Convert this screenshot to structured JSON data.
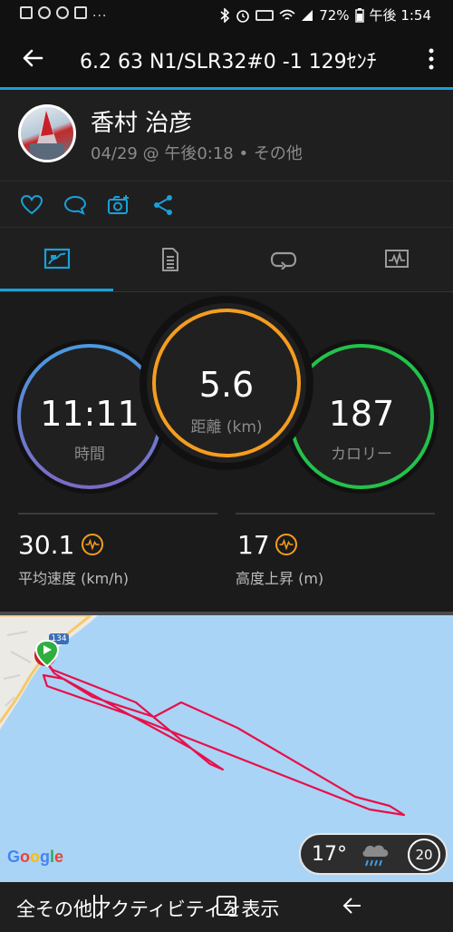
{
  "status_bar": {
    "dots": "...",
    "battery": "72%",
    "time": "午後 1:54"
  },
  "app_bar": {
    "title": "6.2 63 N1/SLR32#0 -1 129ｾﾝﾁ"
  },
  "profile": {
    "name": "香村 治彦",
    "date": "04/29 @ 午後0:18",
    "separator": "•",
    "activity_type": "その他"
  },
  "stats": {
    "time": {
      "value": "11:11",
      "label": "時間"
    },
    "distance": {
      "value": "5.6",
      "label": "距離 (km)"
    },
    "calories": {
      "value": "187",
      "label": "カロリー"
    },
    "avg_speed": {
      "value": "30.1",
      "label": "平均速度 (km/h)"
    },
    "elevation_gain": {
      "value": "17",
      "label": "高度上昇 (m)"
    }
  },
  "map": {
    "road_badge": "134",
    "google_logo": "Google",
    "weather_temp": "17°",
    "wind_speed": "20"
  },
  "bottom": {
    "show_all_label": "全その他アクティビティを表示"
  },
  "colors": {
    "accent": "#1aa0d8",
    "time_ring": "#4f8fd8",
    "distance_ring": "#f59d1f",
    "calories_ring": "#23c24a",
    "track": "#e8104a",
    "water": "#aad4f5"
  }
}
